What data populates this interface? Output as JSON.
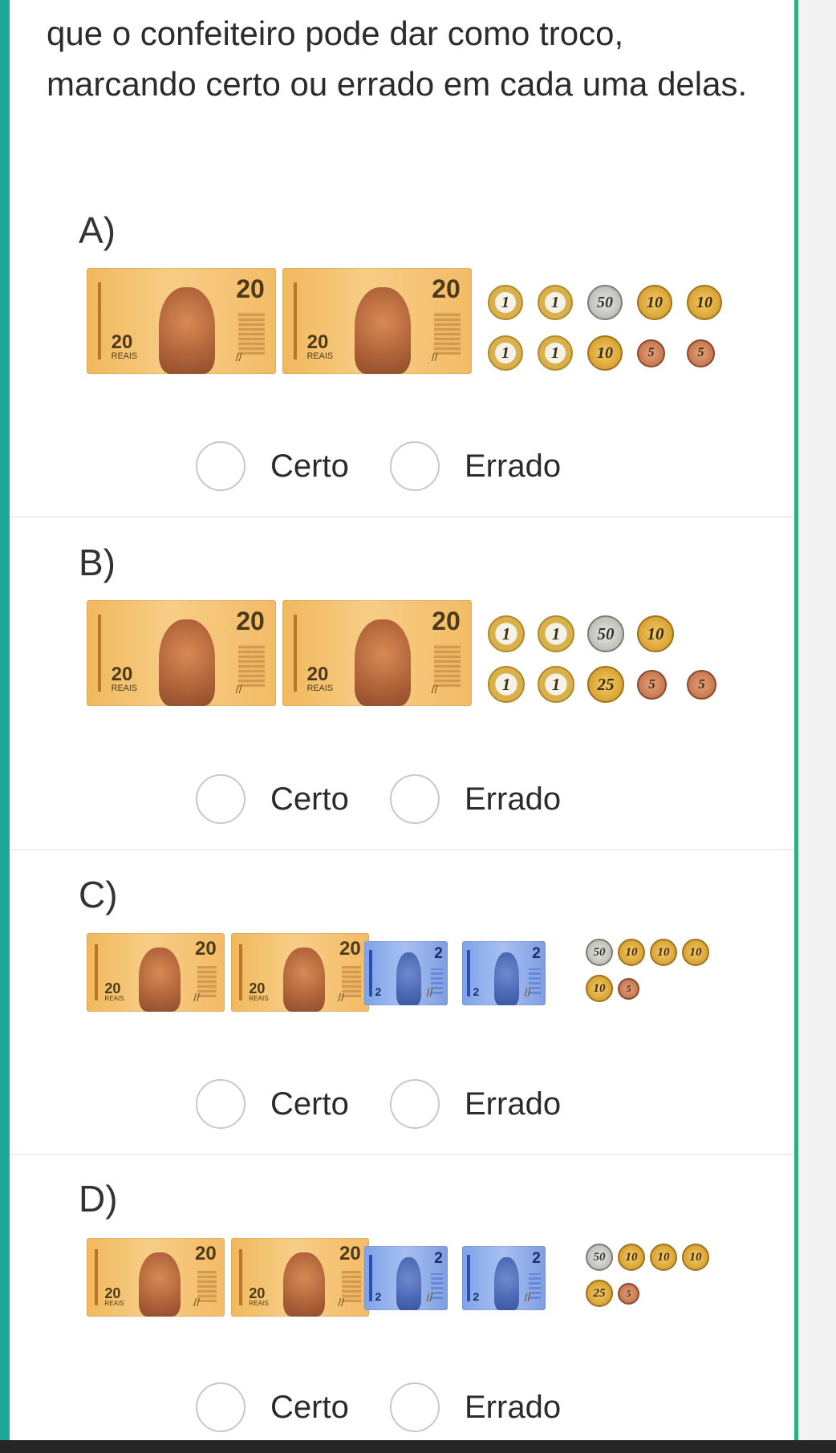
{
  "question_text": "que o confeiteiro pode dar como troco, marcando certo ou errado em cada uma delas.",
  "options": [
    {
      "label": "A)",
      "certo": "Certo",
      "errado": "Errado",
      "notes": [
        {
          "value": "20",
          "text": "20",
          "sub": "REAIS",
          "color": "orange"
        },
        {
          "value": "20",
          "text": "20",
          "sub": "REAIS",
          "color": "orange"
        }
      ],
      "coins_row1": [
        "1",
        "1",
        "50",
        "10",
        "10"
      ],
      "coins_row2": [
        "1",
        "1",
        "10",
        "5",
        "5"
      ]
    },
    {
      "label": "B)",
      "certo": "Certo",
      "errado": "Errado",
      "notes": [
        {
          "value": "20",
          "text": "20",
          "sub": "REAIS",
          "color": "orange"
        },
        {
          "value": "20",
          "text": "20",
          "sub": "REAIS",
          "color": "orange"
        }
      ],
      "coins_row1": [
        "1",
        "1",
        "50",
        "10"
      ],
      "coins_row2": [
        "1",
        "1",
        "25",
        "5",
        "5"
      ]
    },
    {
      "label": "C)",
      "certo": "Certo",
      "errado": "Errado",
      "notes": [
        {
          "value": "20",
          "text": "20",
          "sub": "REAIS",
          "color": "orange"
        },
        {
          "value": "20",
          "text": "20",
          "sub": "REAIS",
          "color": "orange"
        },
        {
          "value": "2",
          "text": "2",
          "sub": "",
          "color": "blue"
        },
        {
          "value": "2",
          "text": "2",
          "sub": "",
          "color": "blue"
        }
      ],
      "coins_row1": [
        "50",
        "10",
        "10",
        "10"
      ],
      "coins_row2": [
        "10",
        "5"
      ]
    },
    {
      "label": "D)",
      "certo": "Certo",
      "errado": "Errado",
      "notes": [
        {
          "value": "20",
          "text": "20",
          "sub": "REAIS",
          "color": "orange"
        },
        {
          "value": "20",
          "text": "20",
          "sub": "REAIS",
          "color": "orange"
        },
        {
          "value": "2",
          "text": "2",
          "sub": "",
          "color": "blue"
        },
        {
          "value": "2",
          "text": "2",
          "sub": "",
          "color": "blue"
        }
      ],
      "coins_row1": [
        "50",
        "10",
        "10",
        "10"
      ],
      "coins_row2": [
        "25",
        "5"
      ]
    }
  ],
  "colors": {
    "left_accent": "#1fa89a",
    "right_accent": "#2bb27c"
  }
}
